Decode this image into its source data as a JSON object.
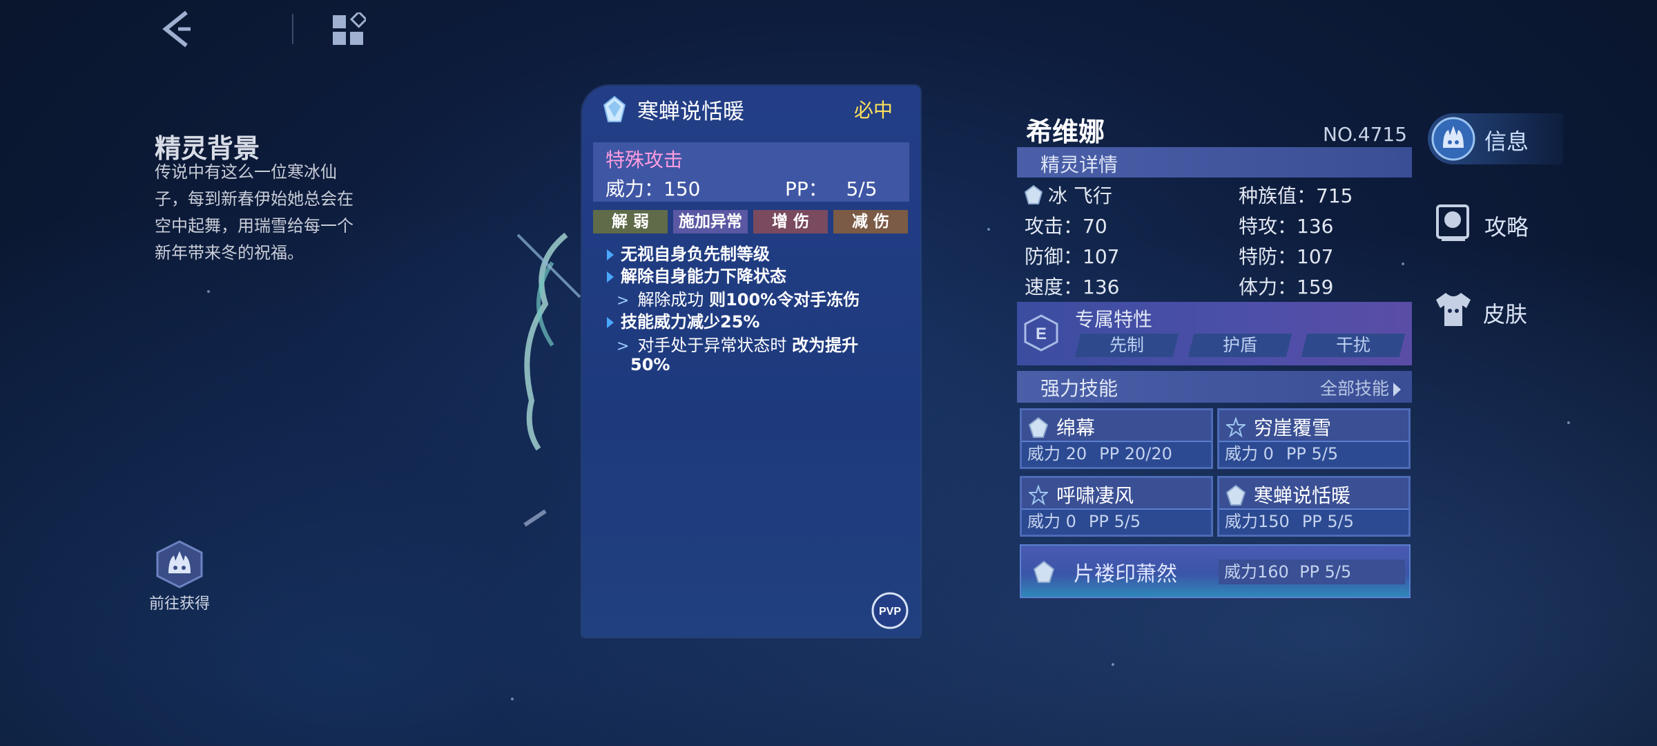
{
  "nav": {
    "back_icon": "back-chevron-icon",
    "menu_icon": "grid-menu-icon"
  },
  "background": {
    "title": "精灵背景",
    "body": "传说中有这么一位寒冰仙子，每到新春伊始她总会在空中起舞，用瑞雪给每一个新年带来冬的祝福。"
  },
  "obtain": {
    "label": "前往获得"
  },
  "skill_detail": {
    "name": "寒蝉说恬暖",
    "accuracy": "必中",
    "category": "特殊攻击",
    "power_label": "威力：",
    "power_value": "150",
    "pp_label": "PP：",
    "pp_value": "5/5",
    "tags": [
      "解 弱",
      "施加异常",
      "增 伤",
      "减 伤"
    ],
    "effects": {
      "e1": "无视自身负先制等级",
      "e2": "解除自身能力下降状态",
      "e3_pre": "解除成功 ",
      "e3_bold": "则100%令对手冻伤",
      "e4": "技能威力减少25%",
      "e5_pre": "对手处于异常状态时 ",
      "e5_bold": "改为提升",
      "e5_cont": "50%"
    },
    "pvp_label": "PVP"
  },
  "pet": {
    "name": "希维娜",
    "number": "NO.4715",
    "detail_label": "精灵详情",
    "types": "冰 飞行",
    "total": "种族值：715",
    "attack": "攻击：70",
    "sp_attack": "特攻：136",
    "defense": "防御：107",
    "sp_defense": "特防：107",
    "speed": "速度：136",
    "hp": "体力：159"
  },
  "traits": {
    "title": "专属特性",
    "items": [
      "先制",
      "护盾",
      "干扰"
    ]
  },
  "power_skills": {
    "title": "强力技能",
    "all_label": "全部技能",
    "cards": [
      {
        "name": "绵幕",
        "power": "威力 20",
        "pp": "PP 20/20"
      },
      {
        "name": "穷崖覆雪",
        "power": "威力 0",
        "pp": "PP 5/5"
      },
      {
        "name": "呼啸凄风",
        "power": "威力 0",
        "pp": "PP 5/5"
      },
      {
        "name": "寒蝉说恬暖",
        "power": "威力150",
        "pp": "PP 5/5"
      }
    ],
    "special": {
      "name": "片褛印萧然",
      "power": "威力160",
      "pp": "PP 5/5"
    }
  },
  "side_nav": {
    "info": "信息",
    "guide": "攻略",
    "skin": "皮肤"
  },
  "colors": {
    "accuracy_yellow": "#ffe25a",
    "category_pink": "#ff9ddf",
    "panel_blue": "#233e86"
  }
}
